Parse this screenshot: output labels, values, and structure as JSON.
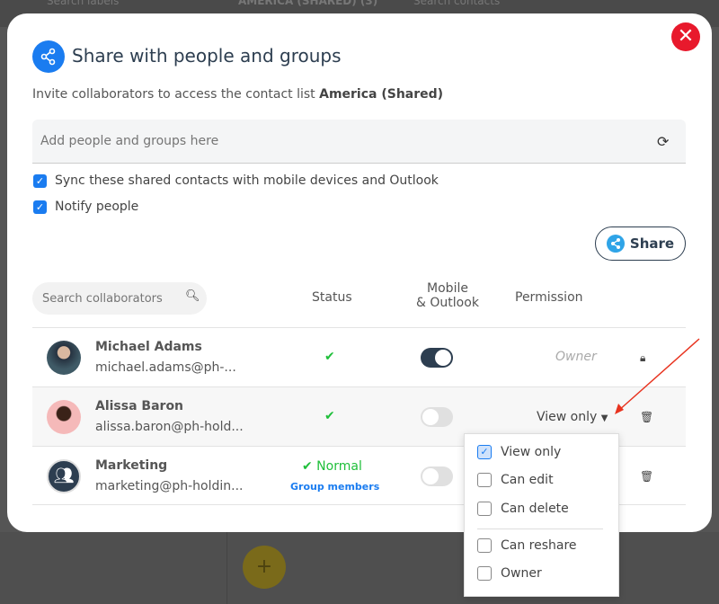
{
  "background": {
    "search_labels": "Search labels",
    "list_header": "AMERICA (SHARED) (3)",
    "search_contacts": "Search contacts",
    "fab": "+"
  },
  "modal": {
    "title": "Share with people and groups",
    "subtitle_prefix": "Invite collaborators to access the contact list ",
    "list_name": "America (Shared)",
    "add_placeholder": "Add people and groups here",
    "sync_label": "Sync these shared contacts with mobile devices and Outlook",
    "notify_label": "Notify people",
    "share_label": "Share",
    "search_placeholder": "Search collaborators",
    "columns": {
      "status": "Status",
      "mobile1": "Mobile",
      "mobile2": "& Outlook",
      "permission": "Permission"
    },
    "collaborators": [
      {
        "name": "Michael Adams",
        "email": "michael.adams@ph-...",
        "status": "✔",
        "mobile_sync": true,
        "permission": "Owner"
      },
      {
        "name": "Alissa Baron",
        "email": "alissa.baron@ph-hold...",
        "status": "✔",
        "mobile_sync": false,
        "permission": "View only"
      },
      {
        "name": "Marketing",
        "email": "marketing@ph-holdin...",
        "status": "✔ Normal",
        "status_link": "Group members",
        "mobile_sync": false
      }
    ],
    "permission_options": [
      {
        "label": "View only",
        "checked": true
      },
      {
        "label": "Can edit",
        "checked": false
      },
      {
        "label": "Can delete",
        "checked": false
      },
      {
        "label": "Can reshare",
        "checked": false
      },
      {
        "label": "Owner",
        "checked": false
      }
    ]
  },
  "colors": {
    "accent": "#1a7cf0",
    "close": "#e8192c",
    "success": "#1fbf3a",
    "annotation_arrow": "#e8331f"
  }
}
